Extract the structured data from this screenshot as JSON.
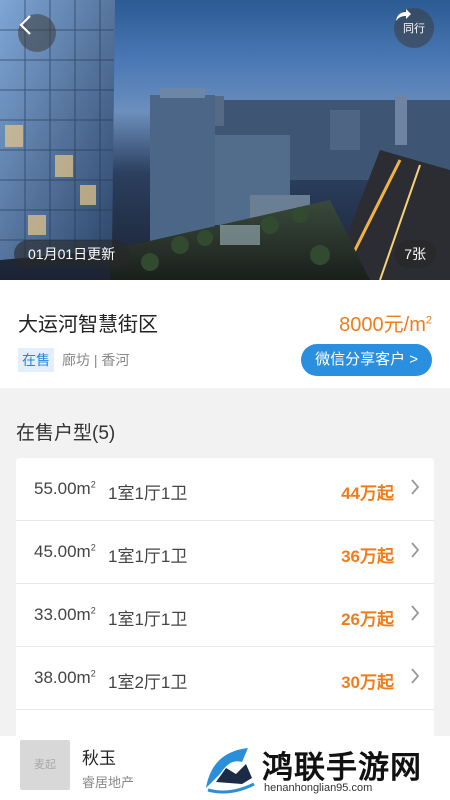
{
  "header": {
    "back_icon": "chevron-left-icon",
    "share_label": "同行",
    "share_icon": "share-arrow-icon",
    "update_text": "01月01日更新",
    "photo_count": "7张"
  },
  "property": {
    "title": "大运河智慧街区",
    "price_value": "8000元/m",
    "price_sup": "2",
    "status_tag": "在售",
    "location": "廊坊 | 香河",
    "share_button": "微信分享客户 >"
  },
  "units_section": {
    "title": "在售户型(5)",
    "units": [
      {
        "area": "55.00m",
        "sup": "2",
        "layout": "1室1厅1卫",
        "price": "44万起"
      },
      {
        "area": "45.00m",
        "sup": "2",
        "layout": "1室1厅1卫",
        "price": "36万起"
      },
      {
        "area": "33.00m",
        "sup": "2",
        "layout": "1室1厅1卫",
        "price": "26万起"
      },
      {
        "area": "38.00m",
        "sup": "2",
        "layout": "1室2厅1卫",
        "price": "30万起"
      }
    ]
  },
  "agent": {
    "avatar_text": "麦起",
    "name": "秋玉",
    "company": "睿居地产"
  },
  "watermark": {
    "title": "鸿联手游网",
    "url": "henanhonglian95.com"
  },
  "colors": {
    "accent_orange": "#f07d1c",
    "accent_blue": "#2b8fe0"
  }
}
